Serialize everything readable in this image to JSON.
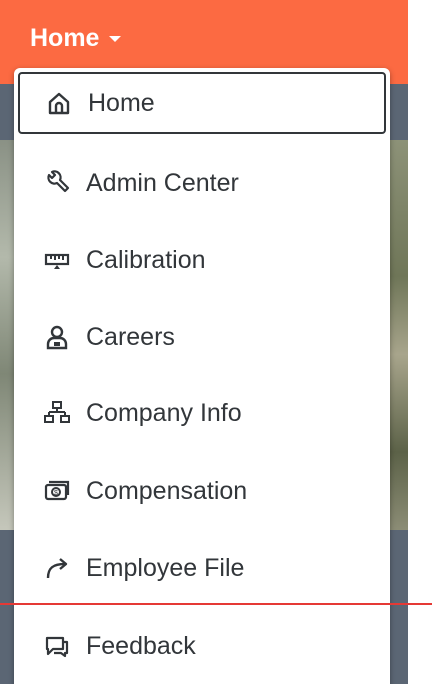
{
  "header": {
    "nav_label": "Home",
    "accent_color": "#fc6a42"
  },
  "menu": {
    "items": [
      {
        "label": "Home",
        "icon": "home-icon",
        "selected": true
      },
      {
        "label": "Admin Center",
        "icon": "wrench-icon",
        "selected": false
      },
      {
        "label": "Calibration",
        "icon": "calibration-icon",
        "selected": false
      },
      {
        "label": "Careers",
        "icon": "careers-icon",
        "selected": false
      },
      {
        "label": "Company Info",
        "icon": "org-chart-icon",
        "selected": false
      },
      {
        "label": "Compensation",
        "icon": "money-icon",
        "selected": false
      },
      {
        "label": "Employee File",
        "icon": "arrow-forward-icon",
        "selected": false
      },
      {
        "label": "Feedback",
        "icon": "feedback-icon",
        "selected": false
      }
    ]
  },
  "annotation": {
    "line_color": "#e53935"
  }
}
